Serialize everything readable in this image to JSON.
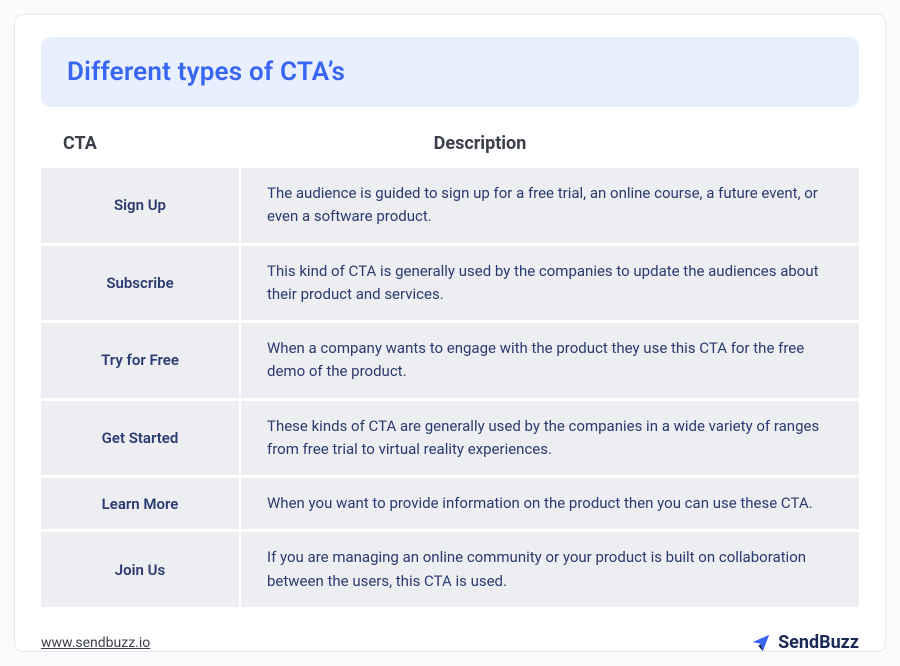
{
  "title": "Different types of CTA’s",
  "headers": {
    "cta": "CTA",
    "description": "Description"
  },
  "rows": [
    {
      "cta": "Sign Up",
      "description": "The audience is guided to sign up for a free trial, an online course, a future event, or even a software product."
    },
    {
      "cta": "Subscribe",
      "description": "This kind of CTA is generally used by the companies to update the audiences about their product and services."
    },
    {
      "cta": "Try for Free",
      "description": "When a company wants to engage with the product they use this CTA for the free demo of the product."
    },
    {
      "cta": "Get Started",
      "description": "These kinds of CTA are generally used by the companies in a wide variety of ranges from free trial to virtual reality experiences."
    },
    {
      "cta": "Learn More",
      "description": "When you want to provide information on the product then you can use these CTA."
    },
    {
      "cta": "Join Us",
      "description": "If you are managing an online community or your product is built on collaboration between the users, this CTA is used."
    }
  ],
  "footer": {
    "link": "www.sendbuzz.io",
    "brand": "SendBuzz"
  }
}
